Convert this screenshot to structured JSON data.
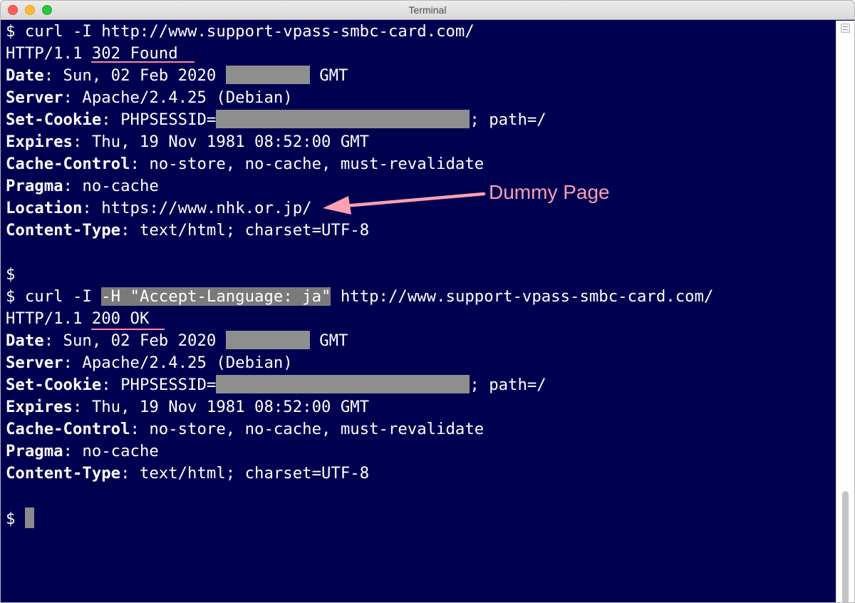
{
  "window": {
    "title": "Terminal"
  },
  "session1": {
    "command": "$ curl -I http://www.support-vpass-smbc-card.com/",
    "status_proto": "HTTP/1.1 ",
    "status_code": "302 Found",
    "date_key": "Date",
    "date_val": ": Sun, 02 Feb 2020 ",
    "date_tz": " GMT",
    "server_key": "Server",
    "server_val": ": Apache/2.4.25 (Debian)",
    "cookie_key": "Set-Cookie",
    "cookie_val": ": PHPSESSID=",
    "cookie_tail": "; path=/",
    "expires_key": "Expires",
    "expires_val": ": Thu, 19 Nov 1981 08:52:00 GMT",
    "cache_key": "Cache-Control",
    "cache_val": ": no-store, no-cache, must-revalidate",
    "pragma_key": "Pragma",
    "pragma_val": ": no-cache",
    "location_key": "Location",
    "location_val": ": https://www.nhk.or.jp/",
    "ctype_key": "Content-Type",
    "ctype_val": ": text/html; charset=UTF-8"
  },
  "prompt_blank": "$",
  "session2": {
    "cmd_prefix": "$ curl -I ",
    "cmd_highlight": "-H \"Accept-Language: ja\"",
    "cmd_suffix": " http://www.support-vpass-smbc-card.com/",
    "status_proto": "HTTP/1.1 ",
    "status_code": "200 OK",
    "date_key": "Date",
    "date_val": ": Sun, 02 Feb 2020 ",
    "date_tz": " GMT",
    "server_key": "Server",
    "server_val": ": Apache/2.4.25 (Debian)",
    "cookie_key": "Set-Cookie",
    "cookie_val": ": PHPSESSID=",
    "cookie_tail": "; path=/",
    "expires_key": "Expires",
    "expires_val": ": Thu, 19 Nov 1981 08:52:00 GMT",
    "cache_key": "Cache-Control",
    "cache_val": ": no-store, no-cache, must-revalidate",
    "pragma_key": "Pragma",
    "pragma_val": ": no-cache",
    "ctype_key": "Content-Type",
    "ctype_val": ": text/html; charset=UTF-8"
  },
  "final_prompt": "$ ",
  "annotation": {
    "text": "Dummy Page",
    "color": "#ff9fb3"
  },
  "colors": {
    "background": "#000050",
    "text": "#ffffff",
    "underline": "#ff86a3",
    "redaction": "#8e8e8e"
  }
}
